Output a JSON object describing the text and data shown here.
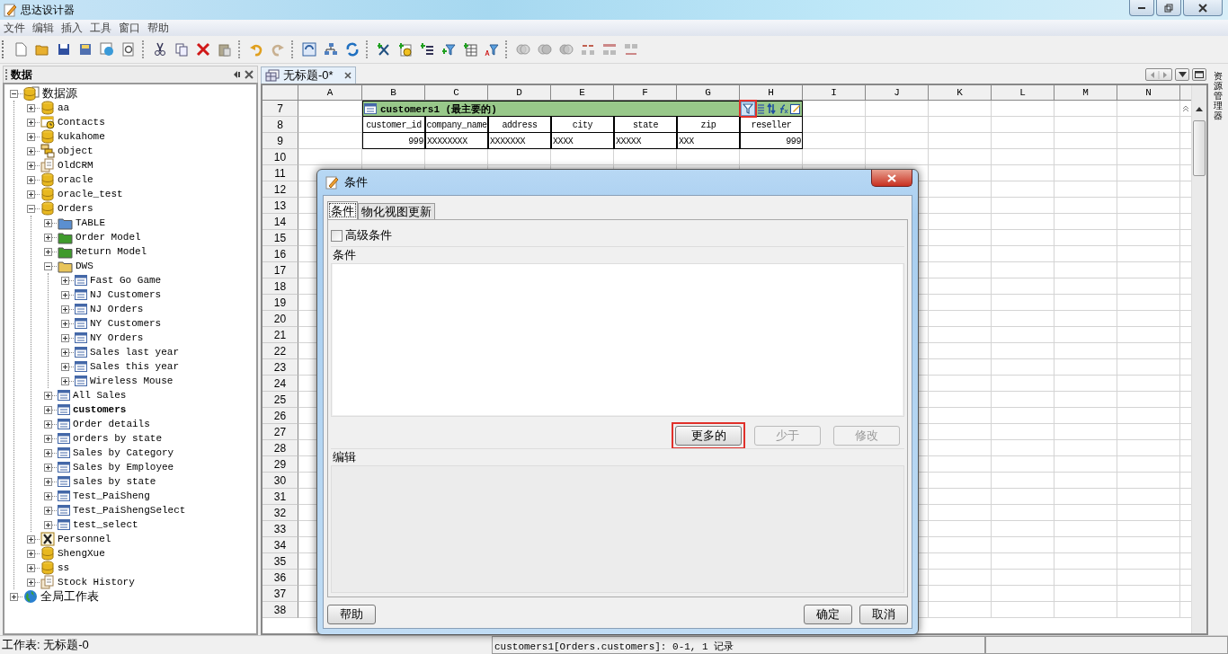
{
  "window": {
    "title": "思达设计器"
  },
  "menu": [
    "文件",
    "编辑",
    "插入",
    "工具",
    "窗口",
    "帮助"
  ],
  "data_panel": {
    "title": "数据",
    "tree": [
      {
        "label": "数据源",
        "kind": "datasource",
        "expanded": true,
        "bold": false,
        "children": [
          {
            "label": "aa",
            "kind": "db",
            "expanded": false,
            "bold": false
          },
          {
            "label": "Contacts",
            "kind": "calendar",
            "expanded": false,
            "bold": false
          },
          {
            "label": "kukahome",
            "kind": "db",
            "expanded": false,
            "bold": false
          },
          {
            "label": "object",
            "kind": "object",
            "expanded": false,
            "bold": false
          },
          {
            "label": "OldCRM",
            "kind": "docs",
            "expanded": false,
            "bold": false
          },
          {
            "label": "oracle",
            "kind": "db",
            "expanded": false,
            "bold": false
          },
          {
            "label": "oracle_test",
            "kind": "db",
            "expanded": false,
            "bold": false
          },
          {
            "label": "Orders",
            "kind": "db",
            "expanded": true,
            "bold": false,
            "children": [
              {
                "label": "TABLE",
                "kind": "folder",
                "color": "#5b8fd0",
                "expanded": false,
                "bold": false
              },
              {
                "label": "Order Model",
                "kind": "folder",
                "color": "#3f9a2c",
                "expanded": false,
                "bold": false
              },
              {
                "label": "Return Model",
                "kind": "folder",
                "color": "#3f9a2c",
                "expanded": false,
                "bold": false
              },
              {
                "label": "DWS",
                "kind": "folder",
                "color": "#e8c45a",
                "expanded": true,
                "bold": false,
                "children": [
                  {
                    "label": "Fast Go Game",
                    "kind": "table",
                    "expanded": false,
                    "bold": false
                  },
                  {
                    "label": "NJ Customers",
                    "kind": "table",
                    "expanded": false,
                    "bold": false
                  },
                  {
                    "label": "NJ Orders",
                    "kind": "table",
                    "expanded": false,
                    "bold": false
                  },
                  {
                    "label": "NY Customers",
                    "kind": "table",
                    "expanded": false,
                    "bold": false
                  },
                  {
                    "label": "NY Orders",
                    "kind": "table",
                    "expanded": false,
                    "bold": false
                  },
                  {
                    "label": "Sales last year",
                    "kind": "table",
                    "expanded": false,
                    "bold": false
                  },
                  {
                    "label": "Sales this year",
                    "kind": "table",
                    "expanded": false,
                    "bold": false
                  },
                  {
                    "label": "Wireless Mouse",
                    "kind": "table",
                    "expanded": false,
                    "bold": false
                  }
                ]
              },
              {
                "label": "All Sales",
                "kind": "table",
                "expanded": false,
                "bold": false
              },
              {
                "label": "customers",
                "kind": "table",
                "expanded": false,
                "bold": true
              },
              {
                "label": "Order details",
                "kind": "table",
                "expanded": false,
                "bold": false
              },
              {
                "label": "orders by state",
                "kind": "table",
                "expanded": false,
                "bold": false
              },
              {
                "label": "Sales by Category",
                "kind": "table",
                "expanded": false,
                "bold": false
              },
              {
                "label": "Sales by Employee",
                "kind": "table",
                "expanded": false,
                "bold": false
              },
              {
                "label": "sales by state",
                "kind": "table",
                "expanded": false,
                "bold": false
              },
              {
                "label": "Test_PaiSheng",
                "kind": "table",
                "expanded": false,
                "bold": false
              },
              {
                "label": "Test_PaiShengSelect",
                "kind": "table",
                "expanded": false,
                "bold": false
              },
              {
                "label": "test_select",
                "kind": "table",
                "expanded": false,
                "bold": false
              }
            ]
          },
          {
            "label": "Personnel",
            "kind": "excel",
            "expanded": false,
            "bold": false
          },
          {
            "label": "ShengXue",
            "kind": "db",
            "expanded": false,
            "bold": false
          },
          {
            "label": "ss",
            "kind": "db",
            "expanded": false,
            "bold": false
          },
          {
            "label": "Stock History",
            "kind": "docs",
            "expanded": false,
            "bold": false
          }
        ]
      },
      {
        "label": "全局工作表",
        "kind": "globe",
        "expanded": false,
        "bold": false
      }
    ]
  },
  "document_tab": {
    "label": "无标题-0*",
    "selected": true
  },
  "side_panel": {
    "label": "资源管理器"
  },
  "sheet": {
    "columns": [
      "A",
      "B",
      "C",
      "D",
      "E",
      "F",
      "G",
      "H",
      "I",
      "J",
      "K",
      "L",
      "M",
      "N"
    ],
    "rows": [
      "7",
      "8",
      "9",
      "10",
      "11",
      "12",
      "13",
      "14",
      "15",
      "16",
      "17",
      "18",
      "19",
      "20",
      "21",
      "22",
      "23",
      "24",
      "25",
      "26",
      "27",
      "28",
      "29",
      "30",
      "31",
      "32",
      "33",
      "34",
      "35",
      "36",
      "37",
      "38"
    ],
    "table": {
      "title": "customers1 (最主要的)",
      "filter_highlighted": true,
      "columns": [
        {
          "label": "customer_id",
          "numeric": true
        },
        {
          "label": "company_name",
          "numeric": false
        },
        {
          "label": "address",
          "numeric": false
        },
        {
          "label": "city",
          "numeric": false
        },
        {
          "label": "state",
          "numeric": false
        },
        {
          "label": "zip",
          "numeric": false
        },
        {
          "label": "reseller",
          "numeric": true
        }
      ],
      "rows": [
        [
          "999",
          "XXXXXXXX",
          "XXXXXXX",
          "XXXX",
          "XXXXX",
          "XXX",
          "999"
        ]
      ]
    }
  },
  "dialog": {
    "title": "条件",
    "tabs": [
      {
        "label": "条件",
        "selected": true
      },
      {
        "label": "物化视图更新",
        "selected": false
      }
    ],
    "advanced": {
      "label": "高级条件",
      "checked": false
    },
    "conditions_group": "条件",
    "list_buttons": [
      {
        "label": "更多的",
        "disabled": false,
        "highlighted": true
      },
      {
        "label": "少于",
        "disabled": true,
        "highlighted": false
      },
      {
        "label": "修改",
        "disabled": true,
        "highlighted": false
      }
    ],
    "edit_group": "编辑",
    "help_button": "帮助",
    "footer_buttons": [
      "确定",
      "取消"
    ]
  },
  "status_bar": {
    "sheet": "工作表: 无标题-0",
    "info": "customers1[Orders.customers]: 0-1, 1 记录"
  }
}
